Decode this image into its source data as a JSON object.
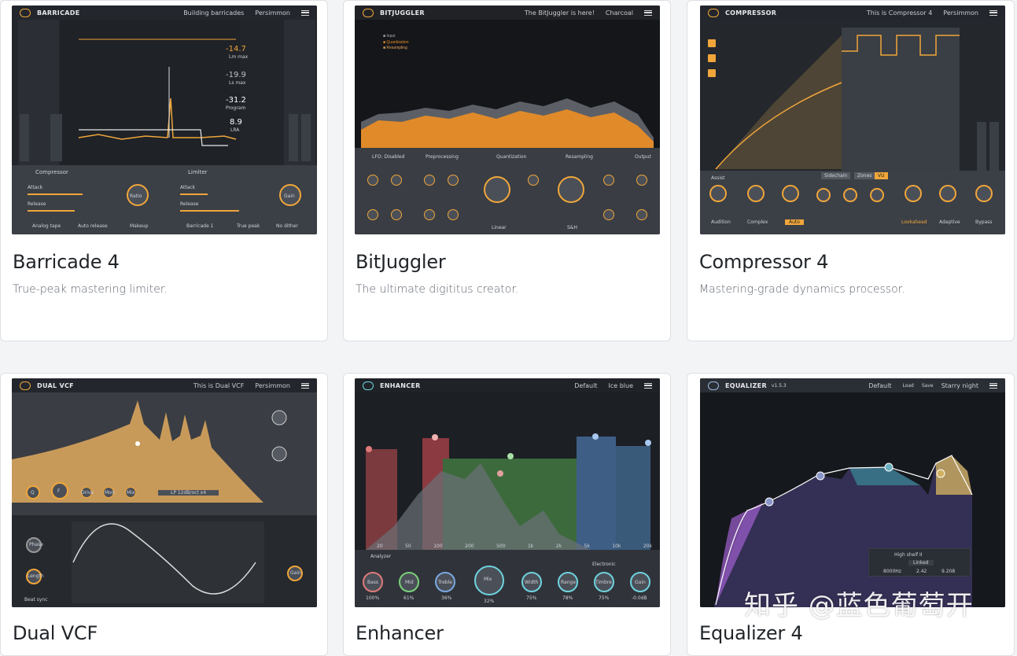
{
  "cards": [
    {
      "title": "Barricade 4",
      "description": "True-peak mastering limiter.",
      "thumb": {
        "plugin_name": "BARRICADE",
        "preset": "Building barricades",
        "theme": "Persimmon",
        "readouts": [
          "-14.7",
          "-19.9",
          "-31.2",
          "8.9"
        ],
        "readout_labels": [
          "Lm max",
          "Ls max",
          "Program",
          "LRA"
        ],
        "sections": [
          "Compressor",
          "Limiter"
        ],
        "params": [
          "Attack",
          "Release",
          "Ratio",
          "Attack",
          "Release",
          "Gain"
        ],
        "footer": [
          "Analog tape",
          "Auto release",
          "Makeup",
          "Barricade 1",
          "True peak",
          "No dither"
        ]
      }
    },
    {
      "title": "BitJuggler",
      "description": "The ultimate digititus creator.",
      "thumb": {
        "plugin_name": "BITJUGGLER",
        "preset": "The BitJuggler is here!",
        "theme": "Charcoal",
        "sections": [
          "LFO: Disabled",
          "Preprocessing",
          "Quantization",
          "Resampling",
          "Output"
        ],
        "params": [
          "Period",
          "Phase",
          "Drive",
          "Emphasis",
          "Depth",
          "Envelope",
          "Rate",
          "A/D",
          "Gain",
          "Depth",
          "Rate",
          "High pass",
          "Width",
          "D/A",
          "Amount"
        ],
        "footer": [
          "Linear",
          "S&H"
        ]
      }
    },
    {
      "title": "Compressor 4",
      "description": "Mastering-grade dynamics processor.",
      "thumb": {
        "plugin_name": "COMPRESSOR",
        "preset": "This is Compressor 4",
        "theme": "Persimmon",
        "params": [
          "Threshold",
          "Ratio",
          "Makeup",
          "Range",
          "Knee",
          "Hold",
          "Attack",
          "Release",
          "Amount"
        ],
        "tabs": [
          "Sidechain",
          "Zones",
          "VU"
        ],
        "assist": "Assist",
        "footer": [
          "Audition",
          "Complex",
          "Auto",
          "Lookahead",
          "Adaptive",
          "Bypass"
        ]
      }
    },
    {
      "title": "Dual VCF",
      "description": "",
      "thumb": {
        "plugin_name": "DUAL VCF",
        "preset": "This is Dual VCF",
        "theme": "Persimmon",
        "params": [
          "Q",
          "F",
          "Drive",
          "Mod",
          "Mix",
          "Phase",
          "Length",
          "Gain"
        ],
        "filter_type": "LP 12dB/oct x4",
        "footer": [
          "Beat sync"
        ]
      }
    },
    {
      "title": "Enhancer",
      "description": "",
      "thumb": {
        "plugin_name": "ENHANCER",
        "preset": "Default",
        "theme": "Ice blue",
        "analyzer": "Analyzer",
        "mode": "Electronic",
        "params": [
          "Bass",
          "Mid",
          "Treble",
          "Mix",
          "Width",
          "Range",
          "Timbre",
          "Gain"
        ],
        "values": [
          "100%",
          "61%",
          "36%",
          "32%",
          "75%",
          "78%",
          "75%",
          "-0.0dB"
        ],
        "freq_ticks": [
          "20",
          "50",
          "100",
          "200",
          "500",
          "1k",
          "2k",
          "5k",
          "10k",
          "20k"
        ]
      }
    },
    {
      "title": "Equalizer 4",
      "description": "",
      "thumb": {
        "plugin_name": "EQUALIZER",
        "version": "v1.5.3",
        "preset": "Default",
        "theme": "Starry night",
        "load": "Load",
        "save": "Save",
        "band_type": "High shelf II",
        "link": "Linked",
        "freq": "8000Hz",
        "q": "2.42",
        "gain": "9.208"
      }
    }
  ],
  "watermark": "知乎 @蓝色葡萄开",
  "colors": {
    "accent_orange": "#f0a63a",
    "panel_dark": "#23262c",
    "card_bg": "#ffffff",
    "page_bg": "#f3f4f6"
  }
}
